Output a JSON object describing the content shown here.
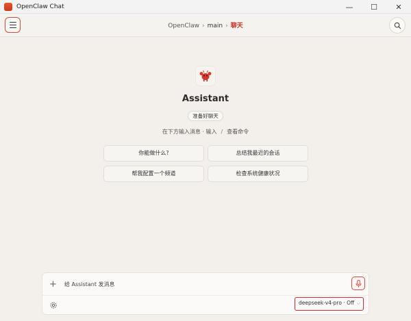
{
  "window": {
    "title": "OpenClaw Chat",
    "controls": {
      "minimize": "—",
      "maximize": "☐",
      "close": "✕"
    }
  },
  "header": {
    "breadcrumb": [
      "OpenClaw",
      "main",
      "聊天"
    ],
    "separator": "›"
  },
  "assistant": {
    "name": "Assistant",
    "status": "准备好聊天",
    "hint_left": "在下方输入消息 · 输入",
    "hint_sep": "/",
    "hint_right": "查看命令"
  },
  "suggestions": [
    "你能做什么?",
    "总结我最近的会话",
    "帮我配置一个频道",
    "检查系统健康状况"
  ],
  "composer": {
    "plus": "+",
    "placeholder": "给 Assistant 发消息",
    "model": "deepseek-v4-pro · Off",
    "model_chevron": "⌵"
  },
  "colors": {
    "accent": "#e04a3a",
    "breadcrumb_current": "#c9342a",
    "background": "#f3f0eb"
  }
}
